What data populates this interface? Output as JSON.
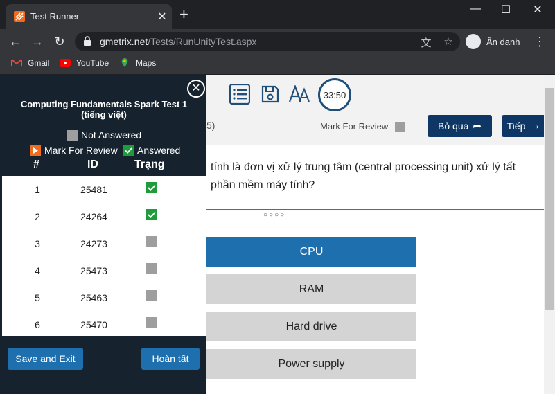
{
  "browser": {
    "tab_title": "Test Runner",
    "url_host": "gmetrix.net",
    "url_path": "/Tests/RunUnityTest.aspx",
    "profile_label": "Ẩn danh",
    "bookmarks": [
      {
        "label": "Gmail",
        "icon": "gmail-icon"
      },
      {
        "label": "YouTube",
        "icon": "youtube-icon"
      },
      {
        "label": "Maps",
        "icon": "maps-icon"
      }
    ]
  },
  "toolbar": {
    "timer": "33:50",
    "partial_question_number": "5)",
    "mark_for_review": "Mark For Review",
    "skip_label": "Bỏ qua",
    "next_label": "Tiếp"
  },
  "question": {
    "text_line1": "tính là đơn vị xử lý trung tâm (central processing unit) xử lý tất",
    "text_line2": "phần mềm máy tính?",
    "dots": "○○○○",
    "answers": [
      {
        "label": "CPU",
        "selected": true
      },
      {
        "label": "RAM",
        "selected": false
      },
      {
        "label": "Hard drive",
        "selected": false
      },
      {
        "label": "Power supply",
        "selected": false
      }
    ]
  },
  "panel": {
    "title_line1": "Computing Fundamentals Spark Test 1",
    "title_line2": "(tiếng việt)",
    "legend_not_answered": "Not Answered",
    "legend_mark_review": "Mark For Review",
    "legend_answered": "Answered",
    "col_num": "#",
    "col_id": "ID",
    "col_status": "Trạng",
    "rows": [
      {
        "num": "1",
        "id": "25481",
        "status": "answered"
      },
      {
        "num": "2",
        "id": "24264",
        "status": "answered"
      },
      {
        "num": "3",
        "id": "24273",
        "status": "not-answered"
      },
      {
        "num": "4",
        "id": "25473",
        "status": "not-answered"
      },
      {
        "num": "5",
        "id": "25463",
        "status": "not-answered"
      },
      {
        "num": "6",
        "id": "25470",
        "status": "not-answered"
      }
    ],
    "save_exit_label": "Save and Exit",
    "finish_label": "Hoàn tất"
  },
  "colors": {
    "panel_bg": "#16222e",
    "accent_blue": "#1e6fad",
    "dark_button": "#0f3766",
    "answered_green": "#1e9b3a",
    "not_answered_gray": "#9e9e9e",
    "mark_review_orange": "#f26b1d"
  }
}
